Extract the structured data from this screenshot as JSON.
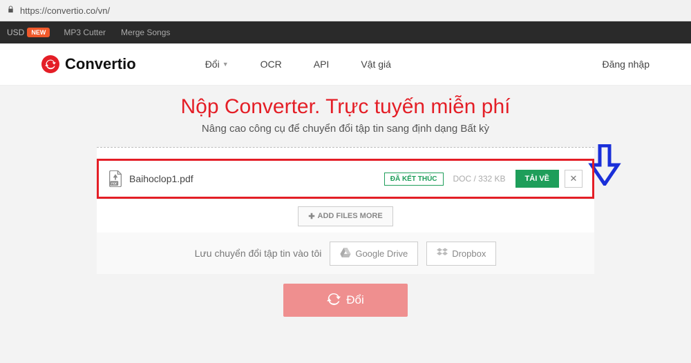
{
  "browser": {
    "url": "https://convertio.co/vn/"
  },
  "topbar": {
    "usd": "USD",
    "new": "NEW",
    "mp3cutter": "MP3 Cutter",
    "mergesongs": "Merge Songs"
  },
  "nav": {
    "brand": "Convertio",
    "convert": "Đổi",
    "ocr": "OCR",
    "api": "API",
    "pricing": "Vật giá",
    "login": "Đăng nhập"
  },
  "hero": {
    "title": "Nộp Converter. Trực tuyến miễn phí",
    "subtitle": "Nâng cao công cụ để chuyển đổi tập tin sang định dạng Bất kỳ"
  },
  "file": {
    "name": "Baihoclop1.pdf",
    "status": "ĐÃ KẾT THÚC",
    "meta": "DOC / 332 KB",
    "download": "TẢI VỀ"
  },
  "addmore": "ADD FILES MORE",
  "save": {
    "text": "Lưu chuyển đổi tập tin vào tôi",
    "gdrive": "Google Drive",
    "dropbox": "Dropbox"
  },
  "convert": "Đổi"
}
